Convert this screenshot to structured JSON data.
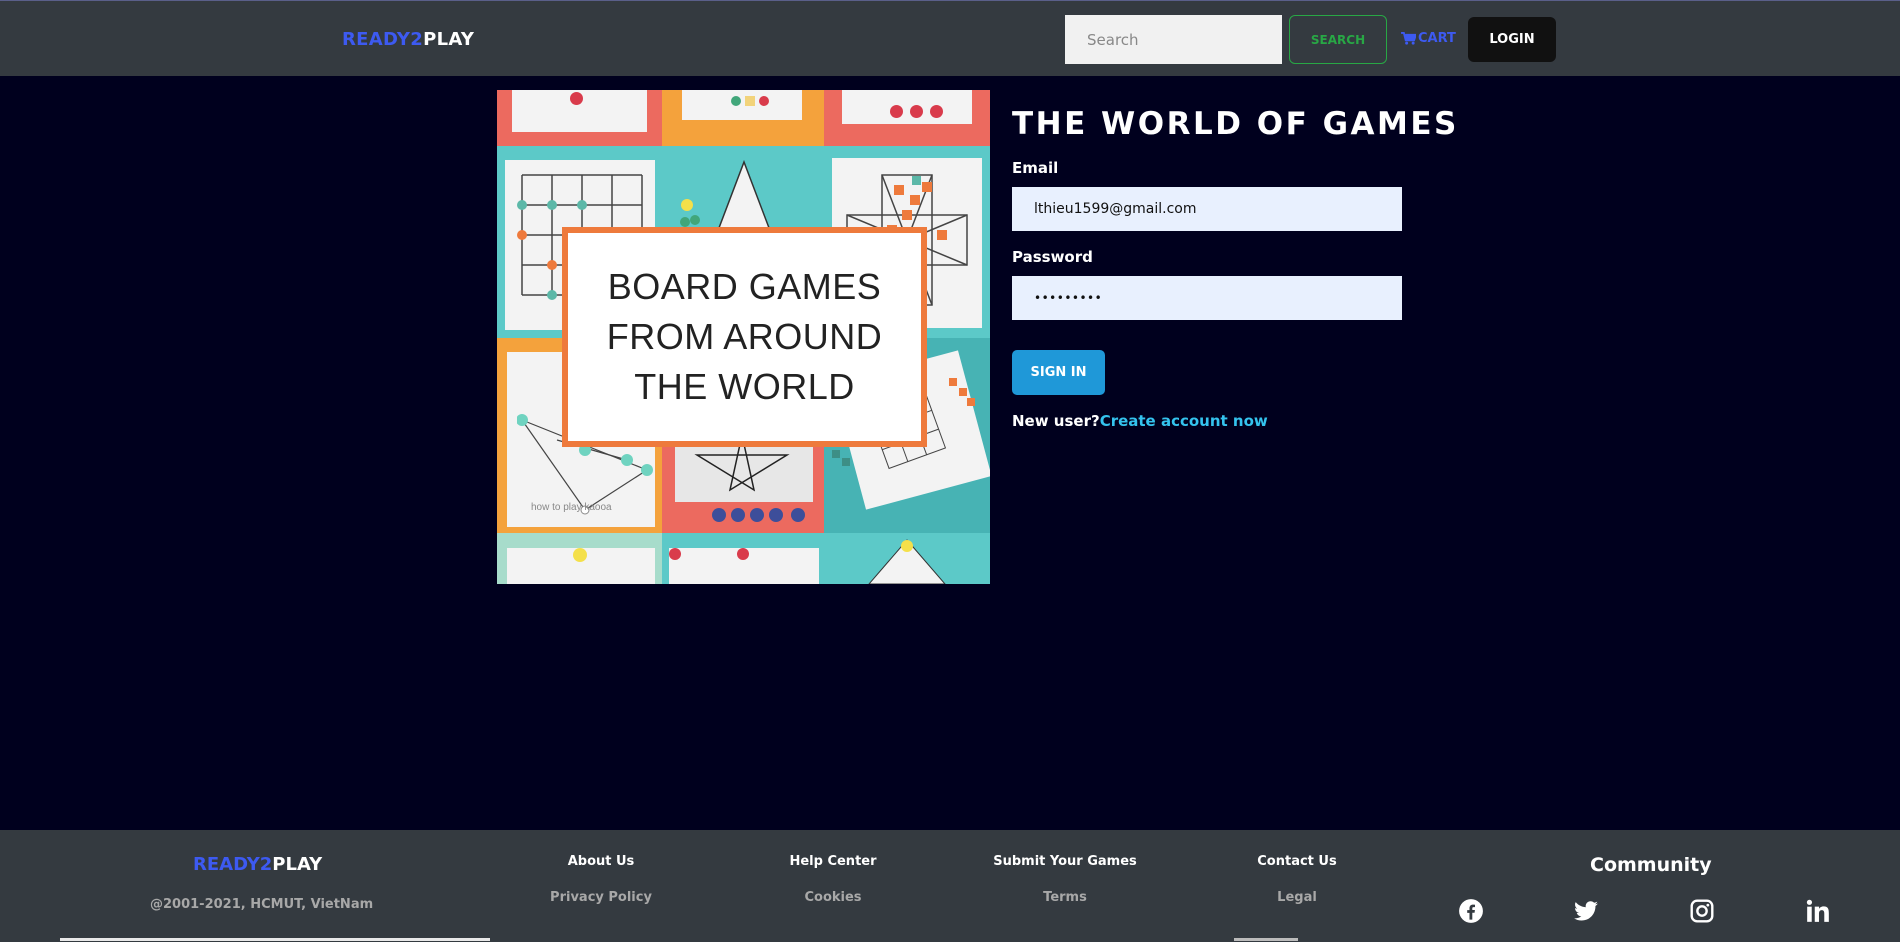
{
  "navbar": {
    "brand_part1": "READY2",
    "brand_part2": "PLAY",
    "search_placeholder": "Search",
    "search_button": "SEARCH",
    "cart_label": "CART",
    "login_button": "LOGIN"
  },
  "hero": {
    "line1": "BOARD GAMES",
    "line2": "FROM AROUND",
    "line3": "THE WORLD",
    "caption": "how to play kaooa"
  },
  "form": {
    "title": "THE WORLD OF GAMES",
    "email_label": "Email",
    "email_value": "lthieu1599@gmail.com",
    "password_label": "Password",
    "password_value": "•••••••••",
    "signin_button": "SIGN IN",
    "new_user_text": "New user?",
    "create_account_link": "Create account now"
  },
  "footer": {
    "brand_part1": "READY2",
    "brand_part2": "PLAY",
    "copyright": "@2001-2021, HCMUT, VietNam",
    "columns": [
      {
        "heading": "About Us",
        "sub": "Privacy Policy"
      },
      {
        "heading": "Help Center",
        "sub": "Cookies"
      },
      {
        "heading": "Submit Your Games",
        "sub": "Terms"
      },
      {
        "heading": "Contact Us",
        "sub": "Legal"
      }
    ],
    "community_title": "Community",
    "social_icons": [
      "facebook-icon",
      "twitter-icon",
      "instagram-icon",
      "linkedin-icon"
    ]
  },
  "colors": {
    "background": "#00001e",
    "navbar": "#343a40",
    "brand_accent": "#3d5af1",
    "search_green": "#28a745",
    "signin_blue": "#1f98d8",
    "link_cyan": "#34c3ee"
  }
}
